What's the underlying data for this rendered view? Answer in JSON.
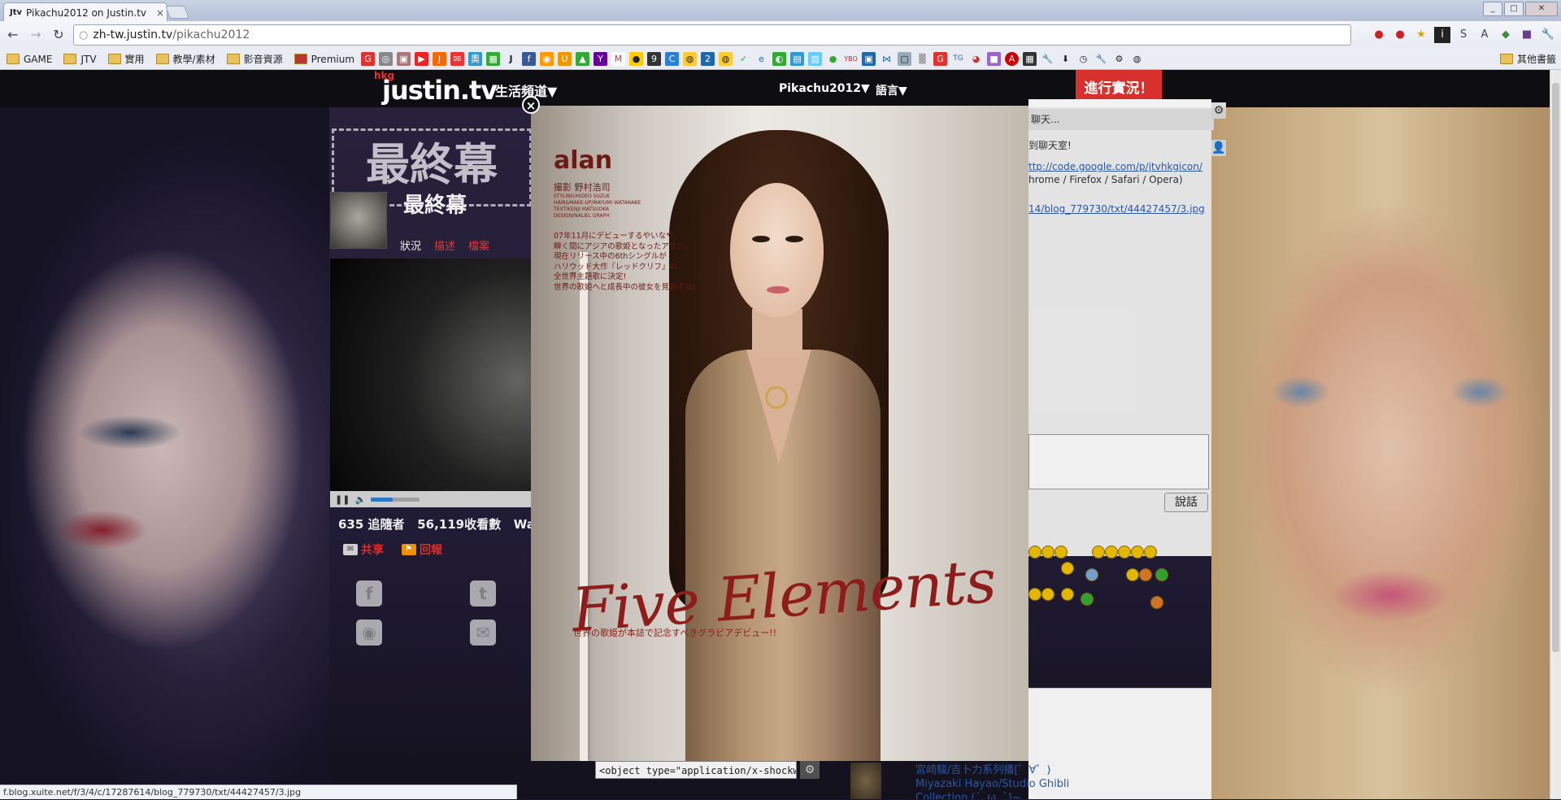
{
  "browser": {
    "tab_title": "Pikachu2012 on Justin.tv",
    "tab_favicon": "Jtv",
    "url_host": "zh-tw.justin.tv",
    "url_path": "/pikachu2012",
    "status_url": "f.blog.xuite.net/f/3/4/c/17287614/blog_779730/txt/44427457/3.jpg"
  },
  "bookmarks": {
    "folders": [
      "GAME",
      "JTV",
      "實用",
      "教學/素材",
      "影音資源"
    ],
    "premium": "Premium",
    "other": "其他書籤"
  },
  "site": {
    "logo": "justin.tv",
    "logo_region": "hkg",
    "nav_life": "生活頻道▼",
    "nav_user": "Pikachu2012▼",
    "nav_lang": "語言▼",
    "go_live": "進行實況！"
  },
  "channel": {
    "banner": "最終幕",
    "name": "最終幕",
    "tabs": [
      "狀況",
      "描述",
      "檔案"
    ],
    "followers": "635 追隨者",
    "views": "56,119收看數",
    "views_more": "Wa",
    "share": "共享",
    "report": "回報"
  },
  "chat": {
    "header": "聊天...",
    "welcome": "到聊天室!",
    "link1": "ttp://code.google.com/p/jtvhkgicon/",
    "browsers": "hrome / Firefox / Safari / Opera)",
    "link2": "14/blog_779730/txt/44427457/3.jpg",
    "say": "說話"
  },
  "video_list": {
    "title_line1": "宮崎駿/吉卜力系列播[゜∀゜)",
    "title_line2": "Miyazaki Hayao/Studio Ghibli",
    "title_line3": "Collection (´,,ω,,`)~"
  },
  "embed_code": "<object type=\"application/x-shockwave",
  "lightbox": {
    "brand": "alan",
    "photographer": "撮影 野村浩司",
    "credits": "STYLING/HIDEO SUZUE\nHAIR&MAKE-UP/MAYUMI WATANABE\nTEXT/KENJI MATSUOKA\nDESIGN/NALIEL GRAPH",
    "description": "07年11月にデビューするやいなや、\n瞬く間にアジアの歌姫となったアラン。\n現在リリース中の6thシングルが\nハリウッド大作『レッドクリフ』の\n全世界主題歌に決定!\n世界の歌姫へと成長中の彼女を見逃すな!",
    "title": "Five Elements",
    "subtitle": "世界の歌姫が本誌で記念すべきグラビアデビュー!!",
    "close": "×"
  },
  "player": {
    "volume": 0.45
  }
}
